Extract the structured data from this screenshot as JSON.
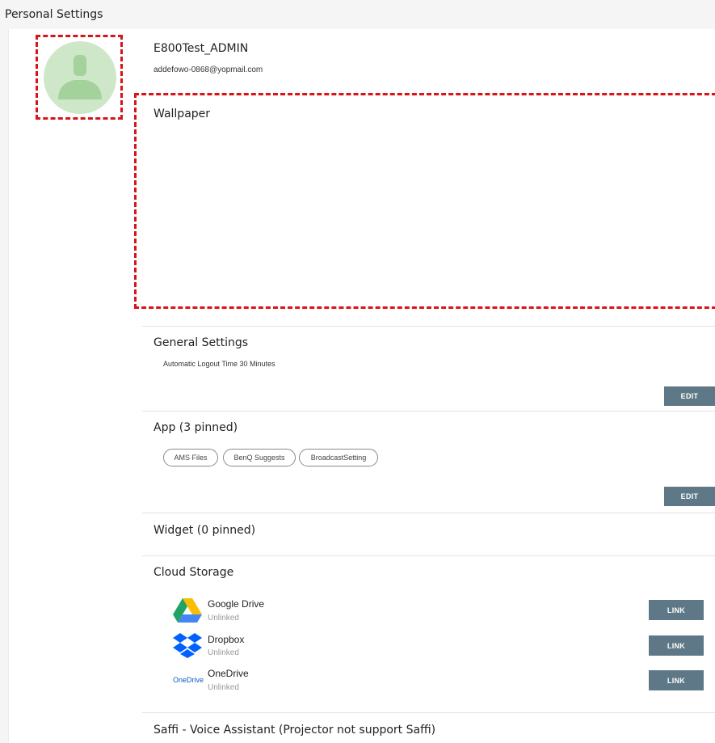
{
  "header": {
    "title": "Personal Settings"
  },
  "profile": {
    "name": "E800Test_ADMIN",
    "email": "addefowo-0868@yopmail.com"
  },
  "wallpaper": {
    "title": "Wallpaper"
  },
  "general": {
    "title": "General Settings",
    "logout_text": "Automatic Logout Time 30 Minutes",
    "edit_label": "EDIT"
  },
  "app": {
    "title": "App (3 pinned)",
    "chips": [
      "AMS Files",
      "BenQ Suggests",
      "BroadcastSetting"
    ],
    "edit_label": "EDIT"
  },
  "widget": {
    "title": "Widget (0 pinned)"
  },
  "cloud": {
    "title": "Cloud Storage",
    "providers": [
      {
        "name": "Google Drive",
        "status": "Unlinked",
        "button": "LINK",
        "icon": "google-drive-icon"
      },
      {
        "name": "Dropbox",
        "status": "Unlinked",
        "button": "LINK",
        "icon": "dropbox-icon"
      },
      {
        "name": "OneDrive",
        "status": "Unlinked",
        "button": "LINK",
        "icon": "onedrive-icon",
        "icon_text": "OneDrive"
      }
    ]
  },
  "saffi": {
    "title": "Saffi - Voice Assistant (Projector not support Saffi)"
  },
  "colors": {
    "accent_button": "#5f7887",
    "highlight_dash": "#d7141a",
    "avatar_bg": "#cde7c8"
  }
}
